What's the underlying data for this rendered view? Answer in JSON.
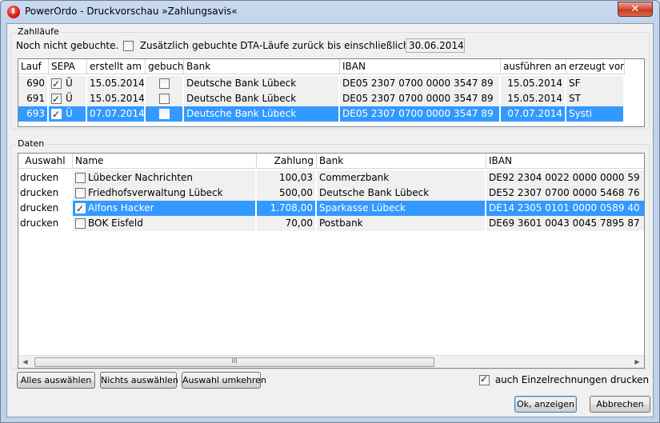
{
  "window": {
    "title": "PowerOrdo - Druckvorschau »Zahlungsavis«",
    "close_label": "✕"
  },
  "zahllaeufe": {
    "legend": "Zahlläufe",
    "not_booked_label": "Noch nicht gebuchte.",
    "additional_label": "Zusätzlich gebuchte DTA-Läufe zurück bis einschließlich:",
    "additional_checked": false,
    "date_value": "30.06.2014",
    "columns": [
      "Lauf",
      "SEPA",
      "erstellt am",
      "gebucht",
      "Bank",
      "IBAN",
      "ausführen am",
      "erzeugt von"
    ],
    "rows": [
      {
        "lauf": "690",
        "sepa_checked": true,
        "sepa_flag": "Ü",
        "erstellt": "15.05.2014",
        "gebucht": false,
        "bank": "Deutsche Bank Lübeck",
        "iban": "DE05 2307 0700 0000 3547 89",
        "ausfuehren": "15.05.2014",
        "erzeugt": "SF",
        "selected": false
      },
      {
        "lauf": "691",
        "sepa_checked": true,
        "sepa_flag": "Ü",
        "erstellt": "15.05.2014",
        "gebucht": false,
        "bank": "Deutsche Bank Lübeck",
        "iban": "DE05 2307 0700 0000 3547 89",
        "ausfuehren": "15.05.2014",
        "erzeugt": "ST",
        "selected": false
      },
      {
        "lauf": "693",
        "sepa_checked": true,
        "sepa_flag": "Ü",
        "erstellt": "07.07.2014",
        "gebucht": false,
        "bank": "Deutsche Bank Lübeck",
        "iban": "DE05 2307 0700 0000 3547 89",
        "ausfuehren": "07.07.2014",
        "erzeugt": "Systi",
        "selected": true
      }
    ]
  },
  "daten": {
    "legend": "Daten",
    "columns": [
      "Auswahl",
      "Name",
      "Zahlung",
      "Bank",
      "IBAN"
    ],
    "rows": [
      {
        "auswahl": "drucken",
        "checked": false,
        "name": "Lübecker Nachrichten",
        "zahlung": "100,03",
        "bank": "Commerzbank",
        "iban": "DE92 2304 0022 0000 0000 59",
        "selected": false
      },
      {
        "auswahl": "drucken",
        "checked": false,
        "name": "Friedhofsverwaltung Lübeck",
        "zahlung": "500,00",
        "bank": "Deutsche Bank Lübeck",
        "iban": "DE52 2307 0700 0000 5468 76",
        "selected": false
      },
      {
        "auswahl": "drucken",
        "checked": true,
        "name": "Alfons Hacker",
        "zahlung": "1.708,00",
        "bank": "Sparkasse Lübeck",
        "iban": "DE14 2305 0101 0000 0589 40",
        "selected": true
      },
      {
        "auswahl": "drucken",
        "checked": false,
        "name": "BOK Eisfeld",
        "zahlung": "70,00",
        "bank": "Postbank",
        "iban": "DE69 3601 0043 0045 7895 87",
        "selected": false
      }
    ],
    "scroll_left": "◀",
    "scroll_right": "▶",
    "scroll_grip": "III"
  },
  "buttons": {
    "select_all": "Alles auswählen",
    "select_none": "Nichts auswählen",
    "invert": "Auswahl umkehren",
    "ok": "Ok, anzeigen",
    "cancel": "Abbrechen"
  },
  "single_invoices": {
    "label": "auch Einzelrechnungen drucken",
    "checked": true
  }
}
